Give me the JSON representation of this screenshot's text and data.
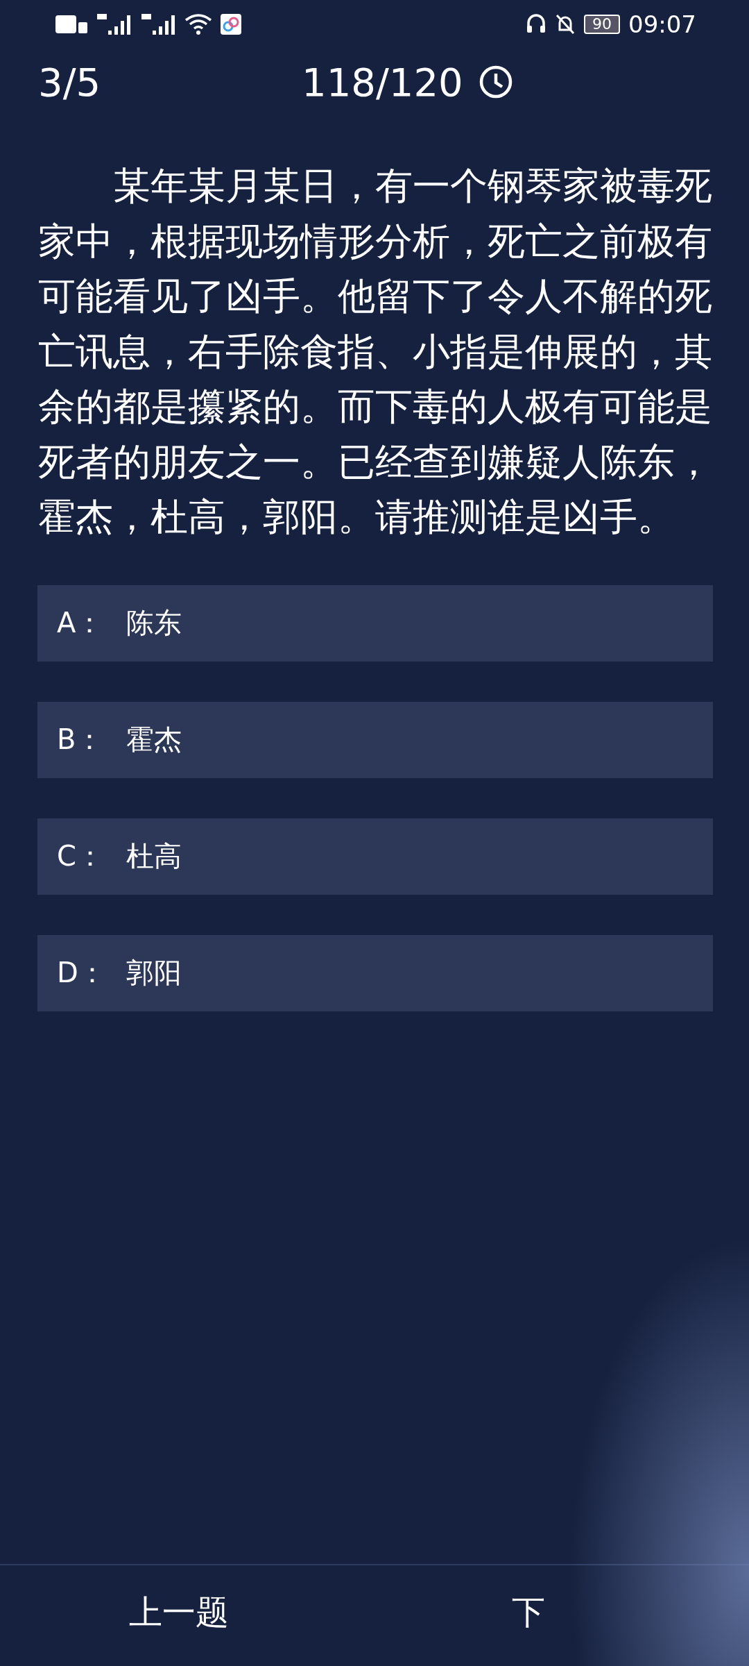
{
  "status_bar": {
    "battery": "90",
    "time": "09:07"
  },
  "header": {
    "progress": "3/5",
    "timer": "118/120"
  },
  "question": {
    "text": "某年某月某日，有一个钢琴家被毒死家中，根据现场情形分析，死亡之前极有可能看见了凶手。他留下了令人不解的死亡讯息，右手除食指、小指是伸展的，其余的都是攥紧的。而下毒的人极有可能是死者的朋友之一。已经查到嫌疑人陈东，霍杰，杜高，郭阳。请推测谁是凶手。"
  },
  "options": [
    {
      "letter": "A：",
      "text": "陈东"
    },
    {
      "letter": "B：",
      "text": "霍杰"
    },
    {
      "letter": "C：",
      "text": "杜高"
    },
    {
      "letter": "D：",
      "text": "郭阳"
    }
  ],
  "nav": {
    "prev": "上一题",
    "next": "下"
  }
}
